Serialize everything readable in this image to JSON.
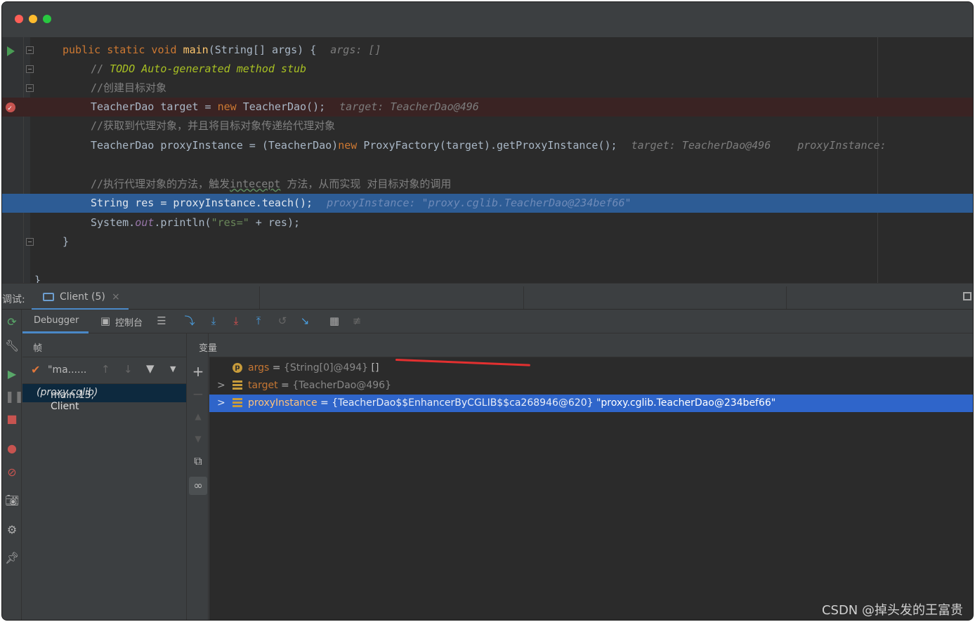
{
  "editor": {
    "lines": {
      "l1": {
        "kw1": "public static void ",
        "fn": "main",
        "rest": "(String[] args) {",
        "hint": "args: []"
      },
      "l2": {
        "prefix": "// ",
        "todo": "TODO Auto-generated method stub"
      },
      "l3": {
        "comment": "//创建目标对象"
      },
      "l4": {
        "code1": "TeacherDao target = ",
        "kw": "new",
        "code2": " TeacherDao();",
        "hint": "target: TeacherDao@496"
      },
      "l5": {
        "comment": "//获取到代理对象，并且将目标对象传递给代理对象"
      },
      "l6": {
        "code1": "TeacherDao proxyInstance = (TeacherDao)",
        "kw": "new",
        "code2": " ProxyFactory(target).getProxyInstance();",
        "hint1": "target: TeacherDao@496",
        "hint2": "proxyInstance:"
      },
      "l7": {
        "comment1": "//执行代理对象的方法，触发",
        "wavy": "intecept",
        "comment2": " 方法，从而实现 对目标对象的调用"
      },
      "l8": {
        "code": "String res = proxyInstance.teach();",
        "hint": "proxyInstance: \"proxy.cglib.TeacherDao@234bef66\""
      },
      "l9": {
        "code1": "System.",
        "field": "out",
        "code2": ".println(",
        "str": "\"res=\"",
        "code3": " + res);"
      },
      "l10": {
        "code": "}"
      },
      "l11": {
        "code": "}"
      }
    }
  },
  "debug": {
    "label": "调试:",
    "session_tab": "Client (5)",
    "close_glyph": "×",
    "tabs": {
      "debugger": "Debugger",
      "console": "控制台"
    },
    "frames_header": "帧",
    "thread_label": "\"ma......",
    "frame": {
      "name": "main:13, Client",
      "pkg": "(proxy.cglib)"
    },
    "variables_header": "变量",
    "variables": [
      {
        "name": "args",
        "type": "{String[0]@494}",
        "value": "[]",
        "icon": "p-icon"
      },
      {
        "name": "target",
        "type": "{TeacherDao@496}",
        "value": "",
        "icon": "field-icon"
      },
      {
        "name": "proxyInstance",
        "type": "{TeacherDao$$EnhancerByCGLIB$$ca268946@620}",
        "value": "\"proxy.cglib.TeacherDao@234bef66\"",
        "icon": "field-icon"
      }
    ],
    "eq": "="
  },
  "watermark": "CSDN @掉头发的王富贵",
  "colors": {
    "accent": "#4a88c7",
    "selection": "#2f65ca",
    "breakpoint": "#c75450",
    "keyword": "#cc7832"
  }
}
